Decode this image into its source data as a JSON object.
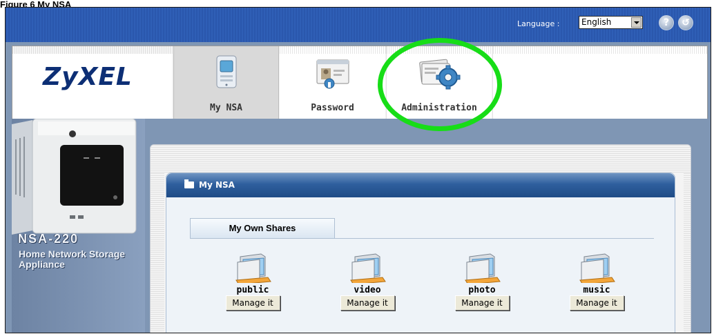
{
  "caption": "Figure 6   My NSA",
  "topbar": {
    "language_label": "Language :",
    "language_value": "English",
    "help_icon": "help-icon",
    "logout_icon": "logout-icon"
  },
  "header": {
    "logo_text": "ZyXEL",
    "tabs": [
      {
        "label": "My NSA",
        "icon": "nsa-device-icon",
        "selected": true
      },
      {
        "label": "Password",
        "icon": "password-card-icon",
        "selected": false
      },
      {
        "label": "Administration",
        "icon": "administration-gear-icon",
        "selected": false
      }
    ]
  },
  "device": {
    "model": "NSA-220",
    "description": "Home Network Storage Appliance"
  },
  "main": {
    "section_title": "My NSA",
    "subtab": "My Own Shares",
    "shares": [
      {
        "name": "public",
        "button": "Manage it"
      },
      {
        "name": "video",
        "button": "Manage it"
      },
      {
        "name": "photo",
        "button": "Manage it"
      },
      {
        "name": "music",
        "button": "Manage it"
      }
    ]
  },
  "colors": {
    "topbar": "#2f5fb6",
    "highlight": "#17dd17",
    "logo": "#0d2f75",
    "section_head": "#2f5f9e"
  }
}
